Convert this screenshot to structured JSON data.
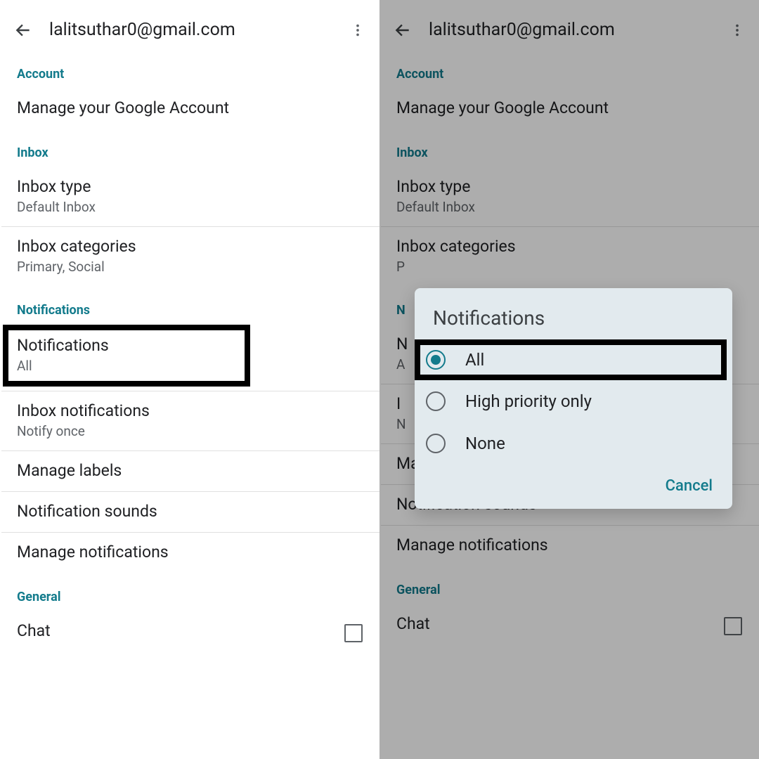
{
  "left": {
    "email": "lalitsuthar0@gmail.com",
    "sections": {
      "account": {
        "header": "Account",
        "manage": "Manage your Google Account"
      },
      "inbox": {
        "header": "Inbox",
        "type_title": "Inbox type",
        "type_value": "Default Inbox",
        "cat_title": "Inbox categories",
        "cat_value": "Primary, Social"
      },
      "notifications": {
        "header": "Notifications",
        "notif_title": "Notifications",
        "notif_value": "All",
        "inboxnotif_title": "Inbox notifications",
        "inboxnotif_value": "Notify once",
        "manage_labels": "Manage labels",
        "notif_sounds": "Notification sounds",
        "manage_notifs": "Manage notifications"
      },
      "general": {
        "header": "General",
        "chat_title": "Chat"
      }
    }
  },
  "right": {
    "email": "lalitsuthar0@gmail.com",
    "sections": {
      "account": {
        "header": "Account",
        "manage": "Manage your Google Account"
      },
      "inbox": {
        "header": "Inbox",
        "type_title": "Inbox type",
        "type_value": "Default Inbox",
        "cat_title": "Inbox categories",
        "cat_value": "P"
      },
      "notifications": {
        "header": "N",
        "notif_title": "N",
        "notif_value": "A",
        "inboxnotif_title": "I",
        "inboxnotif_value": "N",
        "manage_labels": "Manage labels",
        "notif_sounds": "Notification sounds",
        "manage_notifs": "Manage notifications"
      },
      "general": {
        "header": "General",
        "chat_title": "Chat"
      }
    },
    "dialog": {
      "title": "Notifications",
      "options": {
        "all": "All",
        "high": "High priority only",
        "none": "None"
      },
      "cancel": "Cancel"
    }
  }
}
